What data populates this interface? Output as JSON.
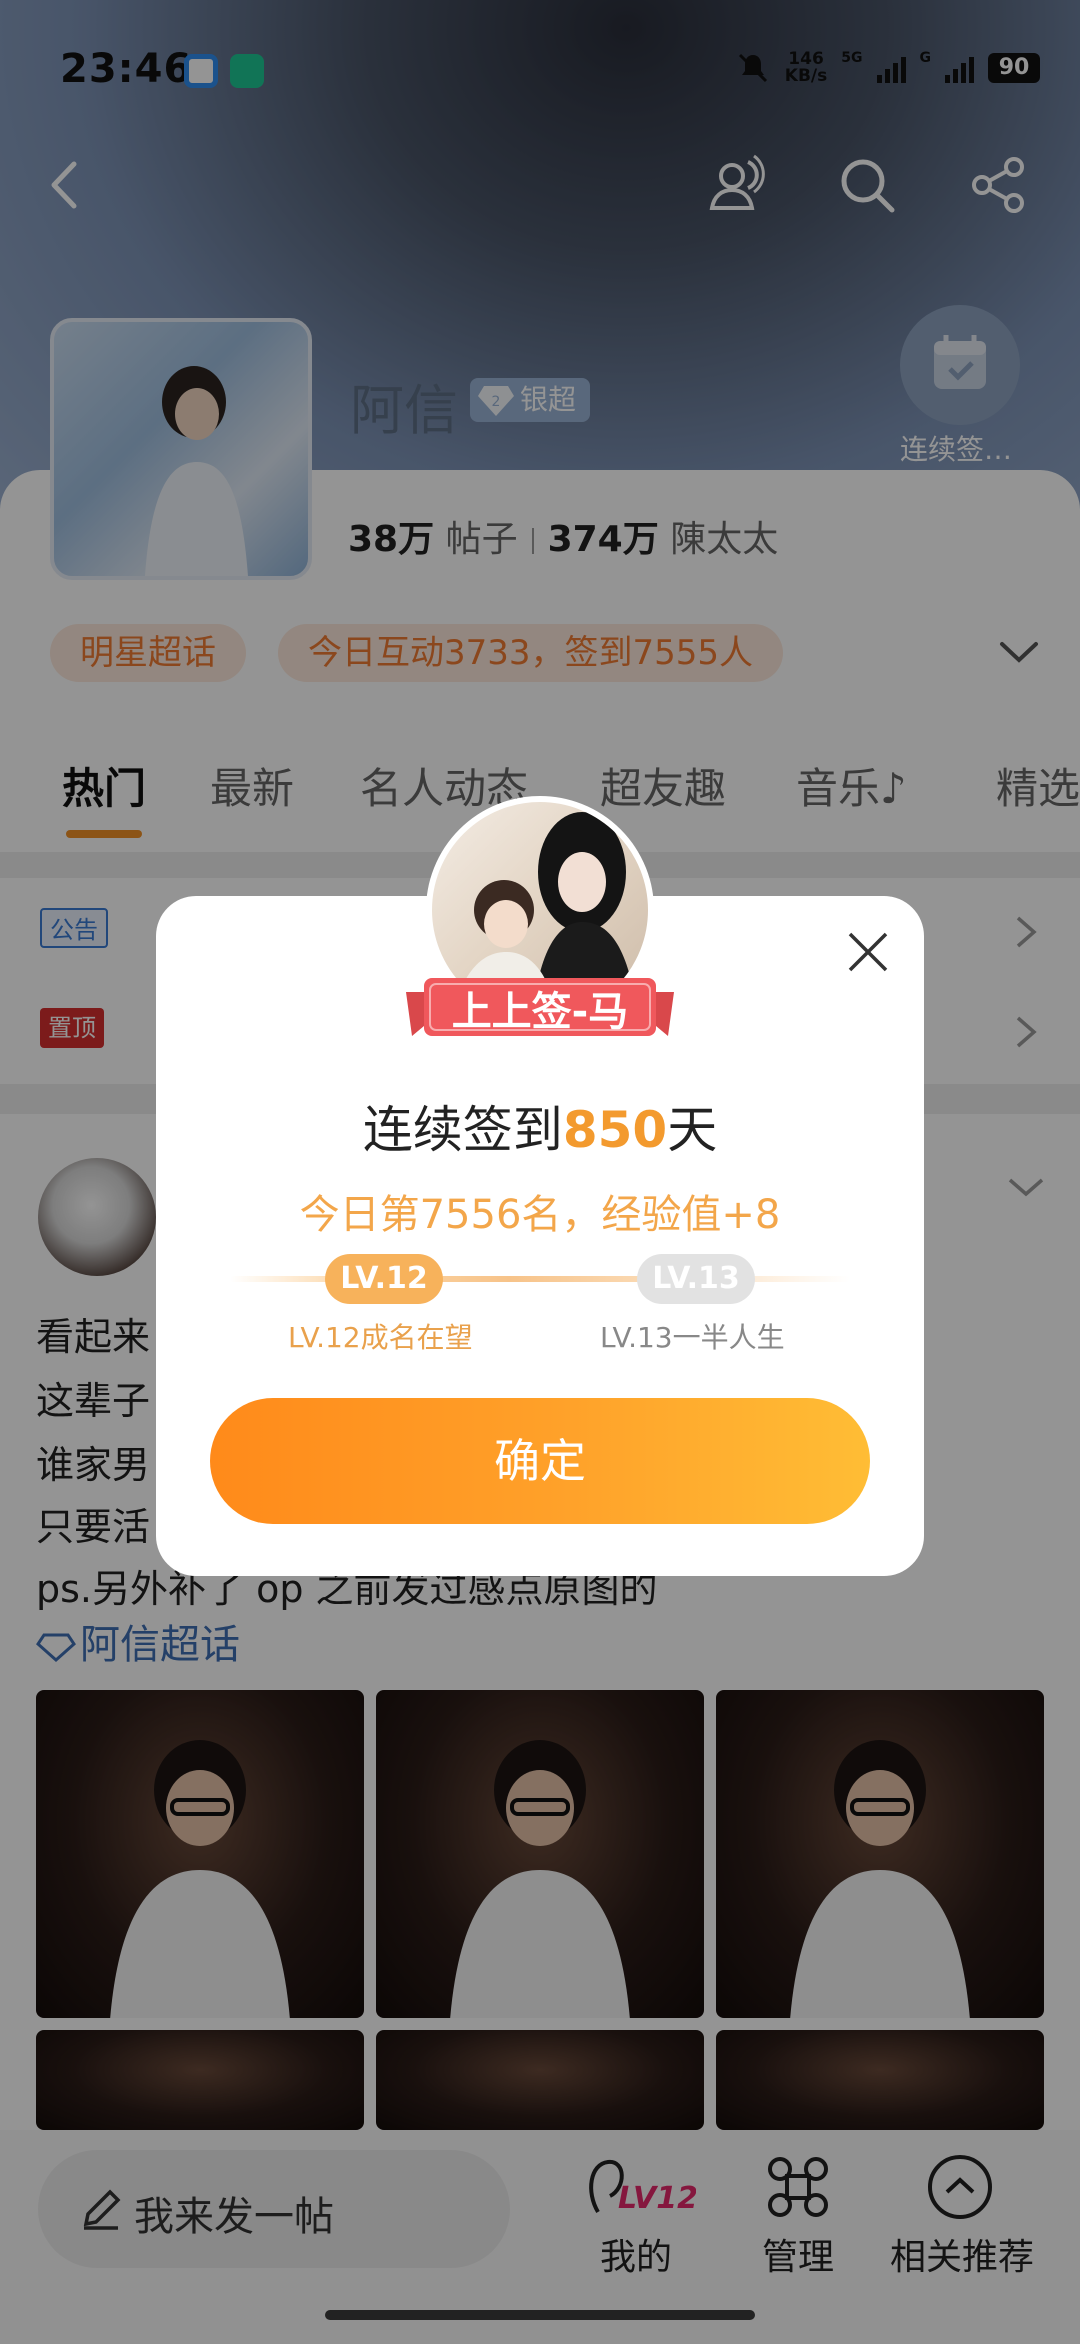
{
  "status_bar": {
    "time": "23:46",
    "net_speed_value": "146",
    "net_speed_unit": "KB/s",
    "signal_1_label": "5G",
    "signal_2_label": "G",
    "battery": "90"
  },
  "header": {
    "super_topic_name": "阿信",
    "tier_badge": "银超",
    "tier_level": "2",
    "checkin_label": "连续签…"
  },
  "stats": {
    "posts_value": "38万",
    "posts_label": "帖子",
    "fans_value": "374万",
    "fans_label": "陳太太"
  },
  "chips": {
    "category": "明星超话",
    "activity": "今日互动3733，签到7555人"
  },
  "tabs": [
    "热门",
    "最新",
    "名人动态",
    "超友趣",
    "音乐♪",
    "精选"
  ],
  "notices": {
    "announcement_tag": "公告",
    "pinned_tag": "置顶"
  },
  "post": {
    "lines": [
      "看起来",
      "这辈子",
      "谁家男",
      "只要活",
      "ps.另外补了 op 之前发过感点原图的"
    ],
    "topic_link": "阿信超话"
  },
  "bottom_bar": {
    "compose_placeholder": "我来发一帖",
    "mine_badge": "LV12",
    "mine_label": "我的",
    "manage_label": "管理",
    "related_label": "相关推荐"
  },
  "modal": {
    "ribbon_text": "上上签-马",
    "title_prefix": "连续签到",
    "streak_days": "850",
    "title_suffix": "天",
    "subtitle": "今日第7556名，经验值+8",
    "current_level": "LV.12",
    "next_level": "LV.13",
    "current_level_caption": "LV.12成名在望",
    "next_level_caption": "LV.13一半人生",
    "confirm_label": "确定"
  },
  "colors": {
    "accent_orange": "#f39a2e",
    "chip_bg": "#fde9dc",
    "topic_link": "#3f6fb3",
    "pinned_red": "#d6302f",
    "announcement_blue": "#3a7bd5"
  }
}
